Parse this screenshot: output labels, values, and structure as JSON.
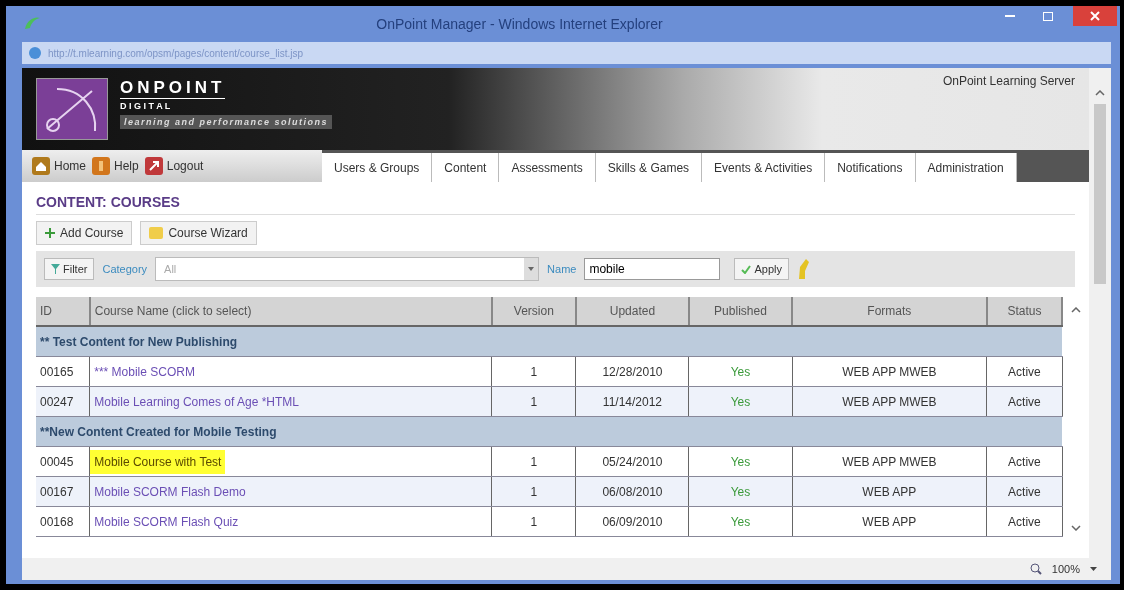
{
  "window": {
    "title": "OnPoint Manager - Windows Internet Explorer"
  },
  "address": "http://t.mlearning.com/opsm/pages/content/course_list.jsp",
  "banner": {
    "brand": "ONPOINT",
    "sub": "D I G I T A L",
    "tagline": "learning and performance solutions",
    "server": "OnPoint Learning Server"
  },
  "links": [
    "Home",
    "Help",
    "Logout"
  ],
  "tabs": [
    {
      "label": "Users & Groups",
      "selected": false
    },
    {
      "label": "Content",
      "selected": false
    },
    {
      "label": "Assessments",
      "selected": false
    },
    {
      "label": "Skills & Games",
      "selected": false
    },
    {
      "label": "Events & Activities",
      "selected": false
    },
    {
      "label": "Notifications",
      "selected": false
    },
    {
      "label": "Administration",
      "selected": false
    }
  ],
  "heading": "CONTENT: COURSES",
  "actions": [
    "Add Course",
    "Course Wizard"
  ],
  "filter": {
    "button": "Filter",
    "category_label": "Category",
    "category_value": "All",
    "name_label": "Name",
    "name_value": "mobile",
    "apply": "Apply"
  },
  "table": {
    "columns": [
      "ID",
      "Course Name (click to select)",
      "Version",
      "Updated",
      "Published",
      "Formats",
      "Status"
    ],
    "rows": [
      {
        "kind": "group",
        "title": "** Test Content for New Publishing"
      },
      {
        "kind": "course",
        "id": "00165",
        "name": "*** Mobile SCORM",
        "version": "1",
        "updated": "12/28/2010",
        "published": "Yes",
        "formats": "WEB APP MWEB",
        "status": "Active",
        "highlighted": false
      },
      {
        "kind": "course",
        "id": "00247",
        "name": "Mobile Learning Comes of Age *HTML",
        "version": "1",
        "updated": "11/14/2012",
        "published": "Yes",
        "formats": "WEB APP MWEB",
        "status": "Active",
        "highlighted": false
      },
      {
        "kind": "group",
        "title": "**New Content Created for Mobile Testing"
      },
      {
        "kind": "course",
        "id": "00045",
        "name": "Mobile Course with Test",
        "version": "1",
        "updated": "05/24/2010",
        "published": "Yes",
        "formats": "WEB APP MWEB",
        "status": "Active",
        "highlighted": true
      },
      {
        "kind": "course",
        "id": "00167",
        "name": "Mobile SCORM Flash Demo",
        "version": "1",
        "updated": "06/08/2010",
        "published": "Yes",
        "formats": "WEB APP",
        "status": "Active",
        "highlighted": false
      },
      {
        "kind": "course",
        "id": "00168",
        "name": "Mobile SCORM Flash Quiz",
        "version": "1",
        "updated": "06/09/2010",
        "published": "Yes",
        "formats": "WEB APP",
        "status": "Active",
        "highlighted": false
      }
    ]
  },
  "status_bar": {
    "zoom": "100%"
  }
}
